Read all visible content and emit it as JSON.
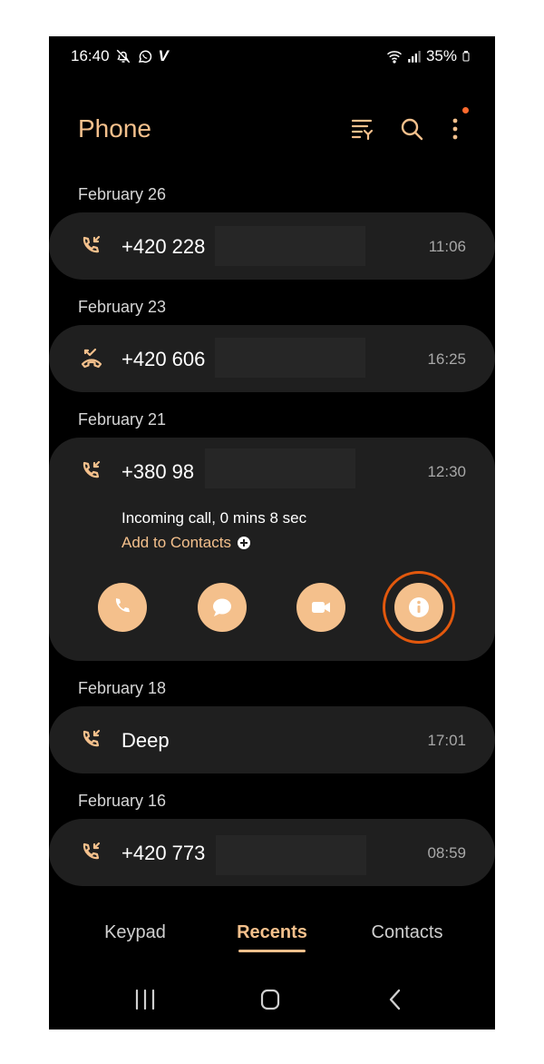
{
  "status": {
    "time": "16:40",
    "v_glyph": "V",
    "battery": "35%"
  },
  "header": {
    "title": "Phone"
  },
  "calls": [
    {
      "date": "February 26",
      "number": "+420 228",
      "time": "11:06",
      "type": "incoming"
    },
    {
      "date": "February 23",
      "number": "+420 606",
      "time": "16:25",
      "type": "missed"
    },
    {
      "date": "February 21",
      "number": "+380 98",
      "time": "12:30",
      "type": "incoming",
      "details": "Incoming call, 0 mins 8 sec",
      "add_to_contacts": "Add to Contacts"
    },
    {
      "date": "February 18",
      "number": "Deep",
      "time": "17:01",
      "type": "incoming"
    },
    {
      "date": "February 16",
      "number": "+420 773",
      "time": "08:59",
      "type": "incoming"
    }
  ],
  "tabs": [
    {
      "label": "Keypad"
    },
    {
      "label": "Recents",
      "active": true
    },
    {
      "label": "Contacts"
    }
  ],
  "colors": {
    "accent": "#f4c08c",
    "highlight_ring": "#e2580d",
    "card": "#1f1f1f",
    "background": "#000000"
  }
}
